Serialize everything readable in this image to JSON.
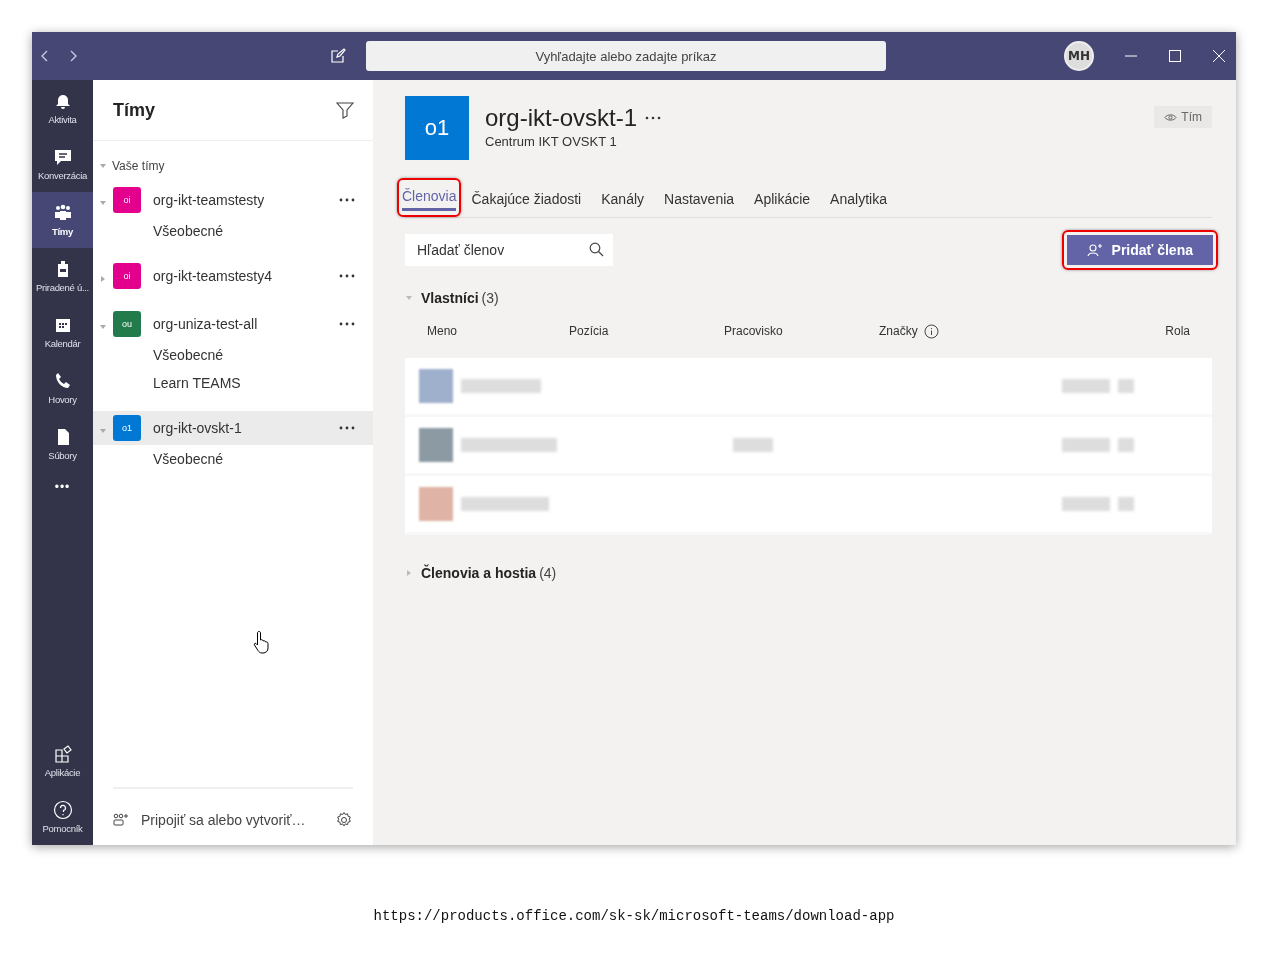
{
  "titlebar": {
    "search_placeholder": "Vyhľadajte alebo zadajte príkaz",
    "avatar_initials": "MH"
  },
  "rail": {
    "items": [
      {
        "label": "Aktivita",
        "selected": false
      },
      {
        "label": "Konverzácia",
        "selected": false
      },
      {
        "label": "Tímy",
        "selected": true
      },
      {
        "label": "Priradené ú...",
        "selected": false
      },
      {
        "label": "Kalendár",
        "selected": false
      },
      {
        "label": "Hovory",
        "selected": false
      },
      {
        "label": "Súbory",
        "selected": false
      }
    ],
    "more": "•••",
    "bottom_items": [
      {
        "label": "Aplikácie"
      },
      {
        "label": "Pomocník"
      }
    ]
  },
  "teams_panel": {
    "title": "Tímy",
    "section": "Vaše tímy",
    "teams": [
      {
        "initials": "oi",
        "color": "#e3008c",
        "name": "org-ikt-teamstesty",
        "expanded": true,
        "selected": false,
        "channels": [
          "Všeobecné"
        ]
      },
      {
        "initials": "oi",
        "color": "#e3008c",
        "name": "org-ikt-teamstesty4",
        "expanded": false,
        "selected": false
      },
      {
        "initials": "ou",
        "color": "#237b4b",
        "name": "org-uniza-test-all",
        "expanded": true,
        "selected": false,
        "channels": [
          "Všeobecné",
          "Learn TEAMS"
        ]
      },
      {
        "initials": "o1",
        "color": "#0078d4",
        "name": "org-ikt-ovskt-1",
        "expanded": true,
        "selected": true,
        "channels": [
          "Všeobecné"
        ]
      }
    ],
    "footer": "Pripojiť sa alebo vytvoriť…"
  },
  "main": {
    "team": {
      "initials": "o1",
      "name": "org-ikt-ovskt-1",
      "description": "Centrum IKT OVSKT 1",
      "badge": "Tím"
    },
    "tabs": [
      {
        "label": "Členovia",
        "selected": true,
        "highlighted": true
      },
      {
        "label": "Čakajúce žiadosti",
        "selected": false,
        "highlighted": false
      },
      {
        "label": "Kanály",
        "selected": false,
        "highlighted": false
      },
      {
        "label": "Nastavenia",
        "selected": false,
        "highlighted": false
      },
      {
        "label": "Aplikácie",
        "selected": false,
        "highlighted": false
      },
      {
        "label": "Analytika",
        "selected": false,
        "highlighted": false
      }
    ],
    "search_placeholder": "Hľadať členov",
    "add_button": {
      "label": "Pridať člena",
      "highlighted": true
    },
    "sections": [
      {
        "title": "Vlastníci",
        "count": "(3)",
        "expanded": true
      },
      {
        "title": "Členovia a hostia",
        "count": "(4)",
        "expanded": false
      }
    ],
    "columns": [
      "Meno",
      "Pozícia",
      "Pracovisko",
      "Značky",
      "Rola"
    ]
  },
  "caption": "https://products.office.com/sk-sk/microsoft-teams/download-app"
}
